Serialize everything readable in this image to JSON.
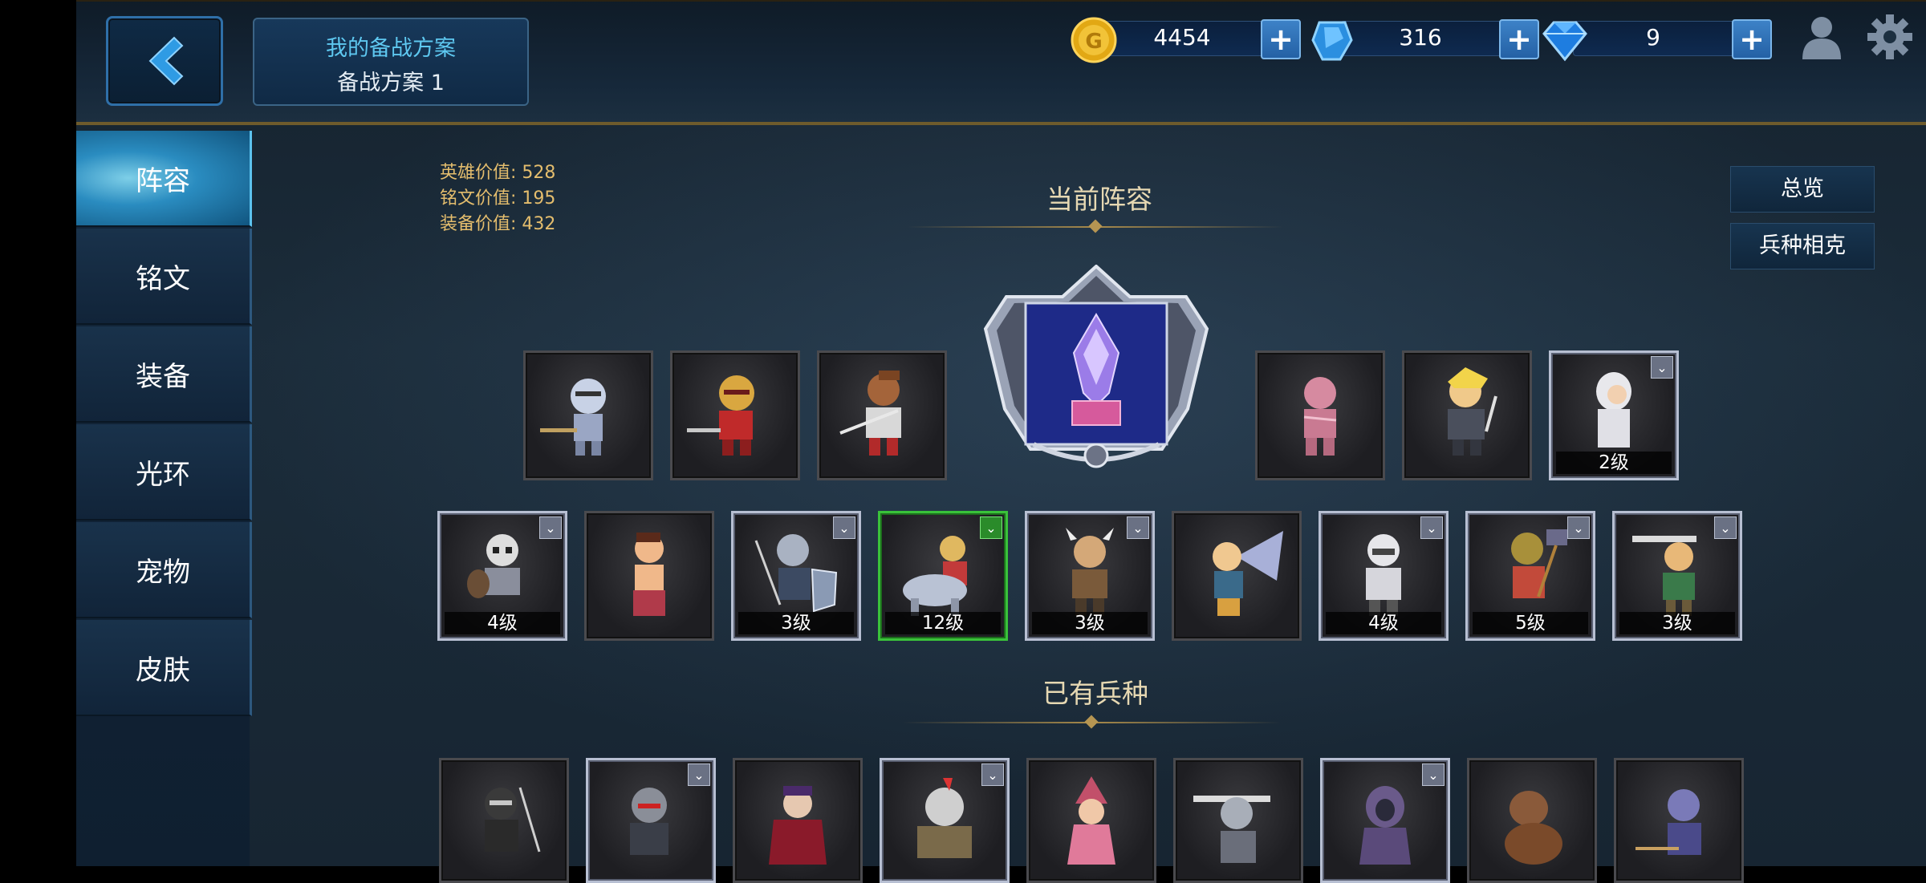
{
  "header": {
    "back_icon": "chevron-left-icon",
    "plan_title": "我的备战方案",
    "plan_name": "备战方案 1",
    "gold": "4454",
    "crystal": "316",
    "diamond": "9",
    "gold_plus": "+",
    "crystal_plus": "+",
    "diamond_plus": "+",
    "profile_icon": "profile-icon",
    "settings_icon": "gear-icon"
  },
  "sidebar": {
    "items": [
      {
        "label": "阵容",
        "active": true
      },
      {
        "label": "铭文",
        "active": false
      },
      {
        "label": "装备",
        "active": false
      },
      {
        "label": "光环",
        "active": false
      },
      {
        "label": "宠物",
        "active": false
      },
      {
        "label": "皮肤",
        "active": false
      }
    ]
  },
  "stats": {
    "hero_value": "英雄价值: 528",
    "rune_value": "铭文价值: 195",
    "equip_value": "装备价值: 432"
  },
  "main": {
    "current_title": "当前阵容",
    "owned_title": "已有兵种",
    "overview_btn": "总览",
    "counter_btn": "兵种相克"
  },
  "lineup_row1": [
    {
      "name": "silver-knight",
      "level": ""
    },
    {
      "name": "red-knight",
      "level": ""
    },
    {
      "name": "samurai",
      "level": ""
    },
    {
      "name": "mummy",
      "level": ""
    },
    {
      "name": "blonde-warrior",
      "level": ""
    },
    {
      "name": "white-hooded-priest",
      "level": "2级"
    }
  ],
  "lineup_row2": [
    {
      "name": "skeleton-warrior",
      "level": "4级"
    },
    {
      "name": "martial-artist",
      "level": ""
    },
    {
      "name": "spear-shield-guard",
      "level": "3级"
    },
    {
      "name": "cavalry-knight",
      "level": "12级"
    },
    {
      "name": "viking-warrior",
      "level": "3级"
    },
    {
      "name": "winged-valkyrie",
      "level": ""
    },
    {
      "name": "white-assassin",
      "level": "4级"
    },
    {
      "name": "hammer-soldier",
      "level": "5级"
    },
    {
      "name": "green-swordsman",
      "level": "3级"
    }
  ],
  "owned_units": [
    "ninja",
    "dark-knight",
    "vampire",
    "armored-ogre",
    "pink-witch",
    "greatsword-knight",
    "hooded-mage",
    "werebear",
    "crossbow-knight"
  ],
  "colors": {
    "accent_blue": "#5ec8f0",
    "gold_text": "#e4bd6d",
    "title_text": "#e6d8b2",
    "green_border": "#3ac23a"
  }
}
